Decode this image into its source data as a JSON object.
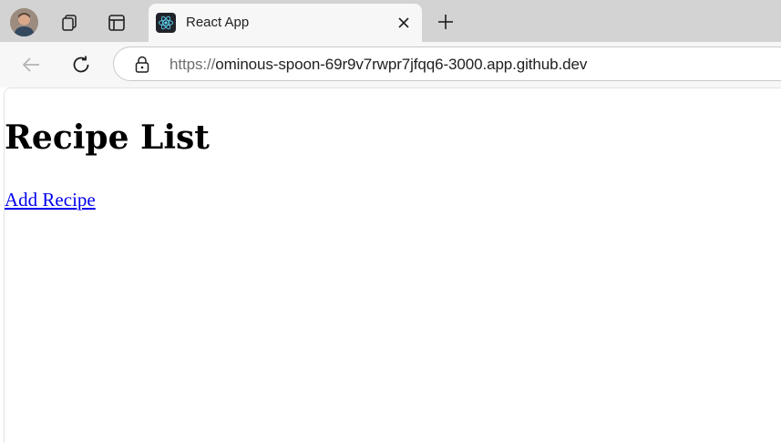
{
  "browser": {
    "tab": {
      "title": "React App"
    },
    "address_bar": {
      "scheme": "https://",
      "host_and_path": "ominous-spoon-69r9v7rwpr7jfqq6-3000.app.github.dev"
    },
    "icons": {
      "profile": "avatar",
      "workspaces": "workspaces-icon",
      "tab_actions": "tab-actions-icon",
      "tab_favicon": "react-icon",
      "close_tab": "close-icon",
      "new_tab": "plus-icon",
      "back": "back-arrow-icon",
      "refresh": "refresh-icon",
      "site_info": "lock-icon"
    },
    "colors": {
      "tabstrip": "#d3d3d3",
      "toolbar": "#f7f7f7",
      "link": "#0000ee"
    }
  },
  "page": {
    "heading": "Recipe List",
    "add_link": "Add Recipe"
  }
}
